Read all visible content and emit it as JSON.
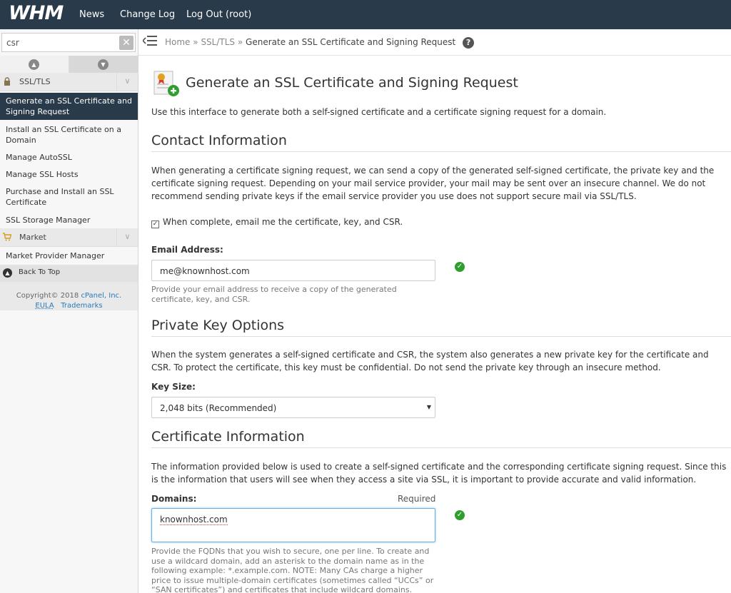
{
  "topbar": {
    "logo": "WHM",
    "nav": [
      "News",
      "Change Log",
      "Log Out (root)"
    ]
  },
  "sidebar": {
    "search_value": "csr",
    "categories": [
      {
        "label": "SSL/TLS"
      },
      {
        "label": "Market"
      }
    ],
    "ssl_items": [
      "Generate an SSL Certificate and Signing Request",
      "Install an SSL Certificate on a Domain",
      "Manage AutoSSL",
      "Manage SSL Hosts",
      "Purchase and Install an SSL Certificate",
      "SSL Storage Manager"
    ],
    "market_items": [
      "Market Provider Manager"
    ],
    "back_to_top": "Back To Top",
    "copyright": "Copyright© 2018",
    "copyright_link": "cPanel, Inc.",
    "eula": "EULA",
    "trademarks": "Trademarks"
  },
  "breadcrumb": {
    "home": "Home",
    "section": "SSL/TLS",
    "current": "Generate an SSL Certificate and Signing Request",
    "sep": "»"
  },
  "page": {
    "title": "Generate an SSL Certificate and Signing Request",
    "intro": "Use this interface to generate both a self-signed certificate and a certificate signing request for a domain."
  },
  "contact": {
    "heading": "Contact Information",
    "description": "When generating a certificate signing request, we can send a copy of the generated self-signed certificate, the private key and the certificate signing request. Depending on your mail service provider, your mail may be sent over an insecure channel. We do not recommend sending private keys if the email service provider you use does not support secure mail via SSL/TLS.",
    "checkbox_label": "When complete, email me the certificate, key, and CSR.",
    "checkbox_checked": true,
    "email_label": "Email Address:",
    "email_value": "me@knownhost.com",
    "email_help": "Provide your email address to receive a copy of the generated certificate, key, and CSR."
  },
  "private_key": {
    "heading": "Private Key Options",
    "description": "When the system generates a self-signed certificate and CSR, the system also generates a new private key for the certificate and CSR. To protect the certificate, this key must be confidential. Do not send the private key through an insecure method.",
    "key_size_label": "Key Size:",
    "key_size_value": "2,048 bits (Recommended)"
  },
  "certificate": {
    "heading": "Certificate Information",
    "description": "The information provided below is used to create a self-signed certificate and the corresponding certificate signing request. Since this is the information that users will see when they access a site via SSL, it is important to provide accurate and valid information.",
    "domains_label": "Domains:",
    "required_label": "Required",
    "domains_value": "knownhost.com",
    "domains_help": "Provide the FQDNs that you wish to secure, one per line. To create and use a wildcard domain, add an asterisk to the domain name as in the following example: *.example.com. NOTE: Many CAs charge a higher price to issue multiple-domain certificates (sometimes called “UCCs” or “SAN certificates”) and certificates that include wildcard domains."
  },
  "colors": {
    "topbar": "#293a4a",
    "active_item": "#293a4a",
    "valid_check": "#2e9e2e",
    "link": "#2a7ab8"
  },
  "icons": [
    "search-clear-icon",
    "sort-up-icon",
    "sort-down-icon",
    "lock-icon",
    "cart-icon",
    "chevron-down-icon",
    "arrow-up-icon",
    "menu-collapse-icon",
    "help-icon",
    "certificate-add-icon",
    "check-valid-icon",
    "select-arrow-icon"
  ]
}
